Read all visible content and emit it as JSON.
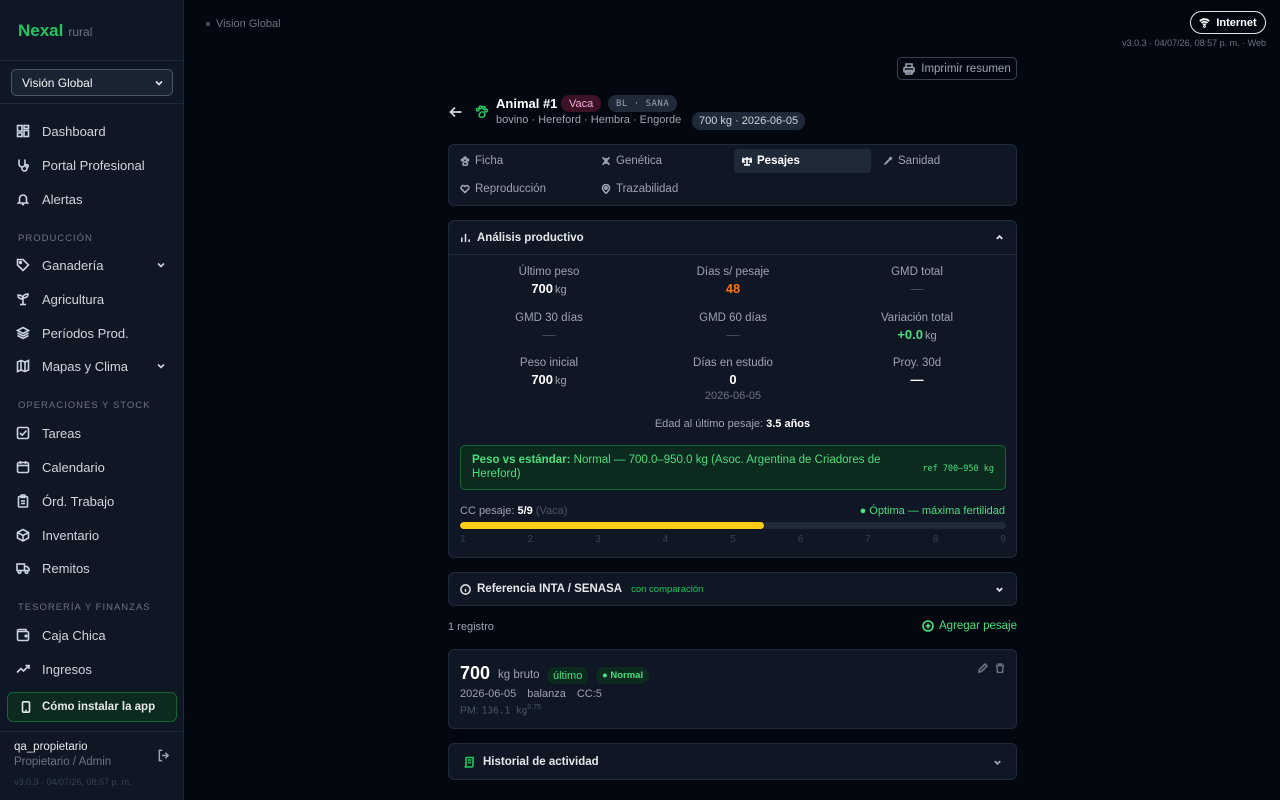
{
  "brand": {
    "name": "Nexal",
    "suffix": "rural"
  },
  "view_selector": {
    "value": "Visión Global"
  },
  "nav": {
    "main": [
      {
        "label": "Dashboard",
        "icon": "dashboard-icon"
      },
      {
        "label": "Portal Profesional",
        "icon": "stethoscope-icon"
      },
      {
        "label": "Alertas",
        "icon": "bell-icon"
      }
    ],
    "sections": [
      {
        "title": "PRODUCCIÓN",
        "items": [
          {
            "label": "Ganadería",
            "icon": "tag-icon",
            "expandable": true
          },
          {
            "label": "Agricultura",
            "icon": "sprout-icon"
          },
          {
            "label": "Períodos Prod.",
            "icon": "layers-icon"
          },
          {
            "label": "Mapas y Clima",
            "icon": "map-icon",
            "expandable": true
          }
        ]
      },
      {
        "title": "OPERACIONES Y STOCK",
        "items": [
          {
            "label": "Tareas",
            "icon": "checkbox-icon"
          },
          {
            "label": "Calendario",
            "icon": "calendar-icon"
          },
          {
            "label": "Órd. Trabajo",
            "icon": "clipboard-icon"
          },
          {
            "label": "Inventario",
            "icon": "package-icon"
          },
          {
            "label": "Remitos",
            "icon": "truck-icon"
          }
        ]
      },
      {
        "title": "TESORERÍA Y FINANZAS",
        "items": [
          {
            "label": "Caja Chica",
            "icon": "wallet-icon"
          },
          {
            "label": "Ingresos",
            "icon": "trending-up-icon"
          }
        ]
      }
    ]
  },
  "install_app": "Cómo instalar la app",
  "user": {
    "name": "qa_propietario",
    "role": "Propietario / Admin"
  },
  "sidebar_version": "v3.0.3 · 04/07/26, 08:57 p. m.",
  "breadcrumb": "Vision Global",
  "connection": "Internet",
  "top_version": "v3.0.3 · 04/07/26, 08:57 p. m. · Web",
  "print_button": "Imprimir resumen",
  "animal": {
    "title": "Animal #1",
    "category": "Vaca",
    "tag": "BL · SANA",
    "subtitle": "bovino · Hereford · Hembra · Engorde",
    "weight_badge": "700 kg · 2026-06-05"
  },
  "tabs": [
    {
      "label": "Ficha",
      "icon": "paw-icon",
      "active": false
    },
    {
      "label": "Genética",
      "icon": "dna-icon",
      "active": false
    },
    {
      "label": "Pesajes",
      "icon": "scale-icon",
      "active": true
    },
    {
      "label": "Sanidad",
      "icon": "syringe-icon",
      "active": false
    },
    {
      "label": "Reproducción",
      "icon": "heart-icon",
      "active": false
    },
    {
      "label": "Trazabilidad",
      "icon": "map-pin-icon",
      "active": false
    }
  ],
  "analysis": {
    "title": "Análisis productivo",
    "stats": [
      {
        "label": "Último peso",
        "value": "700",
        "unit": "kg",
        "style": ""
      },
      {
        "label": "Días s/ pesaje",
        "value": "48",
        "unit": "",
        "style": "orange"
      },
      {
        "label": "GMD total",
        "value": "—",
        "unit": "",
        "style": "dim"
      },
      {
        "label": "GMD 30 días",
        "value": "—",
        "unit": "",
        "style": "dim"
      },
      {
        "label": "GMD 60 días",
        "value": "—",
        "unit": "",
        "style": "dim"
      },
      {
        "label": "Variación total",
        "value": "+0.0",
        "unit": "kg",
        "style": "green"
      },
      {
        "label": "Peso inicial",
        "value": "700",
        "unit": "kg",
        "style": ""
      },
      {
        "label": "Días en estudio",
        "value": "0",
        "unit": "",
        "style": "",
        "sub": "2026-06-05"
      },
      {
        "label": "Proy. 30d",
        "value": "—",
        "unit": "",
        "style": ""
      }
    ],
    "age_label": "Edad al último pesaje:",
    "age_value": "3.5 años",
    "standard_label": "Peso vs estándar:",
    "standard_text": "Normal — 700.0–950.0 kg (Asoc. Argentina de Criadores de Hereford)",
    "standard_ref": "ref 700–950 kg",
    "cc_label": "CC pesaje:",
    "cc_value": "5/9",
    "cc_category": "(Vaca)",
    "cc_status": "● Óptima — máxima fertilidad",
    "cc_fraction": 0.556,
    "cc_ticks": [
      "1",
      "2",
      "3",
      "4",
      "5",
      "6",
      "7",
      "8",
      "9"
    ],
    "colors": {
      "fill": "#facc15",
      "accent": "#22c55e"
    }
  },
  "reference": {
    "title": "Referencia INTA / SENASA",
    "tag": "con comparación"
  },
  "records": {
    "count": "1 registro",
    "add_label": "Agregar pesaje",
    "items": [
      {
        "weight": "700",
        "unit": "kg bruto",
        "latest": "último",
        "status": "● Normal",
        "date": "2026-06-05",
        "method": "balanza",
        "cc": "CC:5",
        "pm_label": "PM:",
        "pm_value": "136.1 kg",
        "pm_exp": "0.75"
      }
    ]
  },
  "history": {
    "title": "Historial de actividad"
  }
}
